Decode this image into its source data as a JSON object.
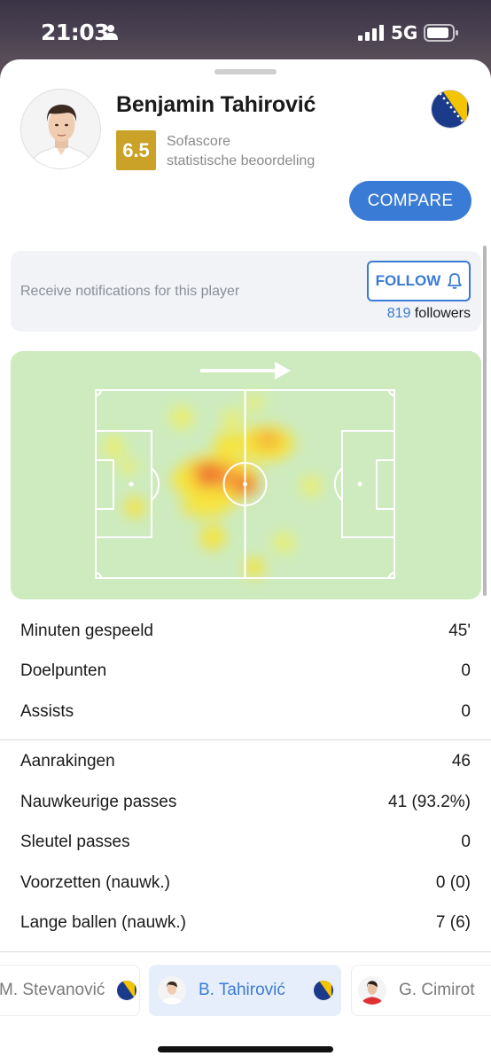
{
  "status_bar": {
    "time": "21:03",
    "network": "5G",
    "icons": [
      "person-icon",
      "signal-icon",
      "battery-icon"
    ]
  },
  "player": {
    "name": "Benjamin Tahirović",
    "rating": "6.5",
    "rating_source_line1": "Sofascore",
    "rating_source_line2": "statistische beoordeling",
    "compare_label": "COMPARE",
    "flag": "bosnia-flag-icon"
  },
  "notifications": {
    "text": "Receive notifications for this player",
    "follow_label": "FOLLOW",
    "followers_count": "819",
    "followers_label": "followers"
  },
  "heatmap": {
    "direction_icon": "arrow-right-icon"
  },
  "stats_group1": [
    {
      "label": "Minuten gespeeld",
      "value": "45'"
    },
    {
      "label": "Doelpunten",
      "value": "0"
    },
    {
      "label": "Assists",
      "value": "0"
    }
  ],
  "stats_group2": [
    {
      "label": "Aanrakingen",
      "value": "46"
    },
    {
      "label": "Nauwkeurige passes",
      "value": "41 (93.2%)"
    },
    {
      "label": "Sleutel passes",
      "value": "0"
    },
    {
      "label": "Voorzetten (nauwk.)",
      "value": "0 (0)"
    },
    {
      "label": "Lange ballen (nauwk.)",
      "value": "7 (6)"
    }
  ],
  "player_tabs": [
    {
      "label": "M. Stevanović",
      "active": false
    },
    {
      "label": "B. Tahirović",
      "active": true
    },
    {
      "label": "G. Cimirot",
      "active": false
    }
  ],
  "colors": {
    "accent": "#3a7bd5",
    "rating_badge": "#c9a227",
    "pitch": "#cdebbf"
  }
}
